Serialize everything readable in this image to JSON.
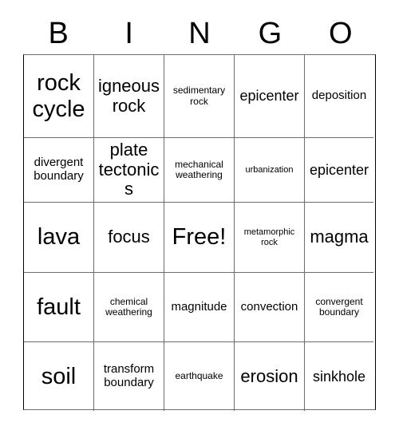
{
  "card": {
    "title_letters": [
      "B",
      "I",
      "N",
      "G",
      "O"
    ],
    "free_space_label": "Free!",
    "grid": {
      "columns": 5,
      "rows": 5,
      "cells": [
        {
          "text": "rock cycle",
          "size": "xl"
        },
        {
          "text": "igneous rock",
          "size": "lg"
        },
        {
          "text": "sedimentary rock",
          "size": "xs"
        },
        {
          "text": "epicenter",
          "size": "md"
        },
        {
          "text": "deposition",
          "size": "sm"
        },
        {
          "text": "divergent boundary",
          "size": "sm"
        },
        {
          "text": "plate tectonics",
          "size": "lg"
        },
        {
          "text": "mechanical weathering",
          "size": "xs"
        },
        {
          "text": "urbanization",
          "size": "xxs"
        },
        {
          "text": "epicenter",
          "size": "md"
        },
        {
          "text": "lava",
          "size": "xl"
        },
        {
          "text": "focus",
          "size": "lg"
        },
        {
          "text": "Free!",
          "size": "xl"
        },
        {
          "text": "metamorphic rock",
          "size": "xxs"
        },
        {
          "text": "magma",
          "size": "lg"
        },
        {
          "text": "fault",
          "size": "xl"
        },
        {
          "text": "chemical weathering",
          "size": "xs"
        },
        {
          "text": "magnitude",
          "size": "sm"
        },
        {
          "text": "convection",
          "size": "sm"
        },
        {
          "text": "convergent boundary",
          "size": "xs"
        },
        {
          "text": "soil",
          "size": "xl"
        },
        {
          "text": "transform boundary",
          "size": "sm"
        },
        {
          "text": "earthquake",
          "size": "xs"
        },
        {
          "text": "erosion",
          "size": "lg"
        },
        {
          "text": "sinkhole",
          "size": "md"
        }
      ]
    },
    "colors": {
      "background": "#ffffff",
      "text": "#000000",
      "grid_line": "#6e6e6e",
      "grid_border": "#000000"
    }
  }
}
